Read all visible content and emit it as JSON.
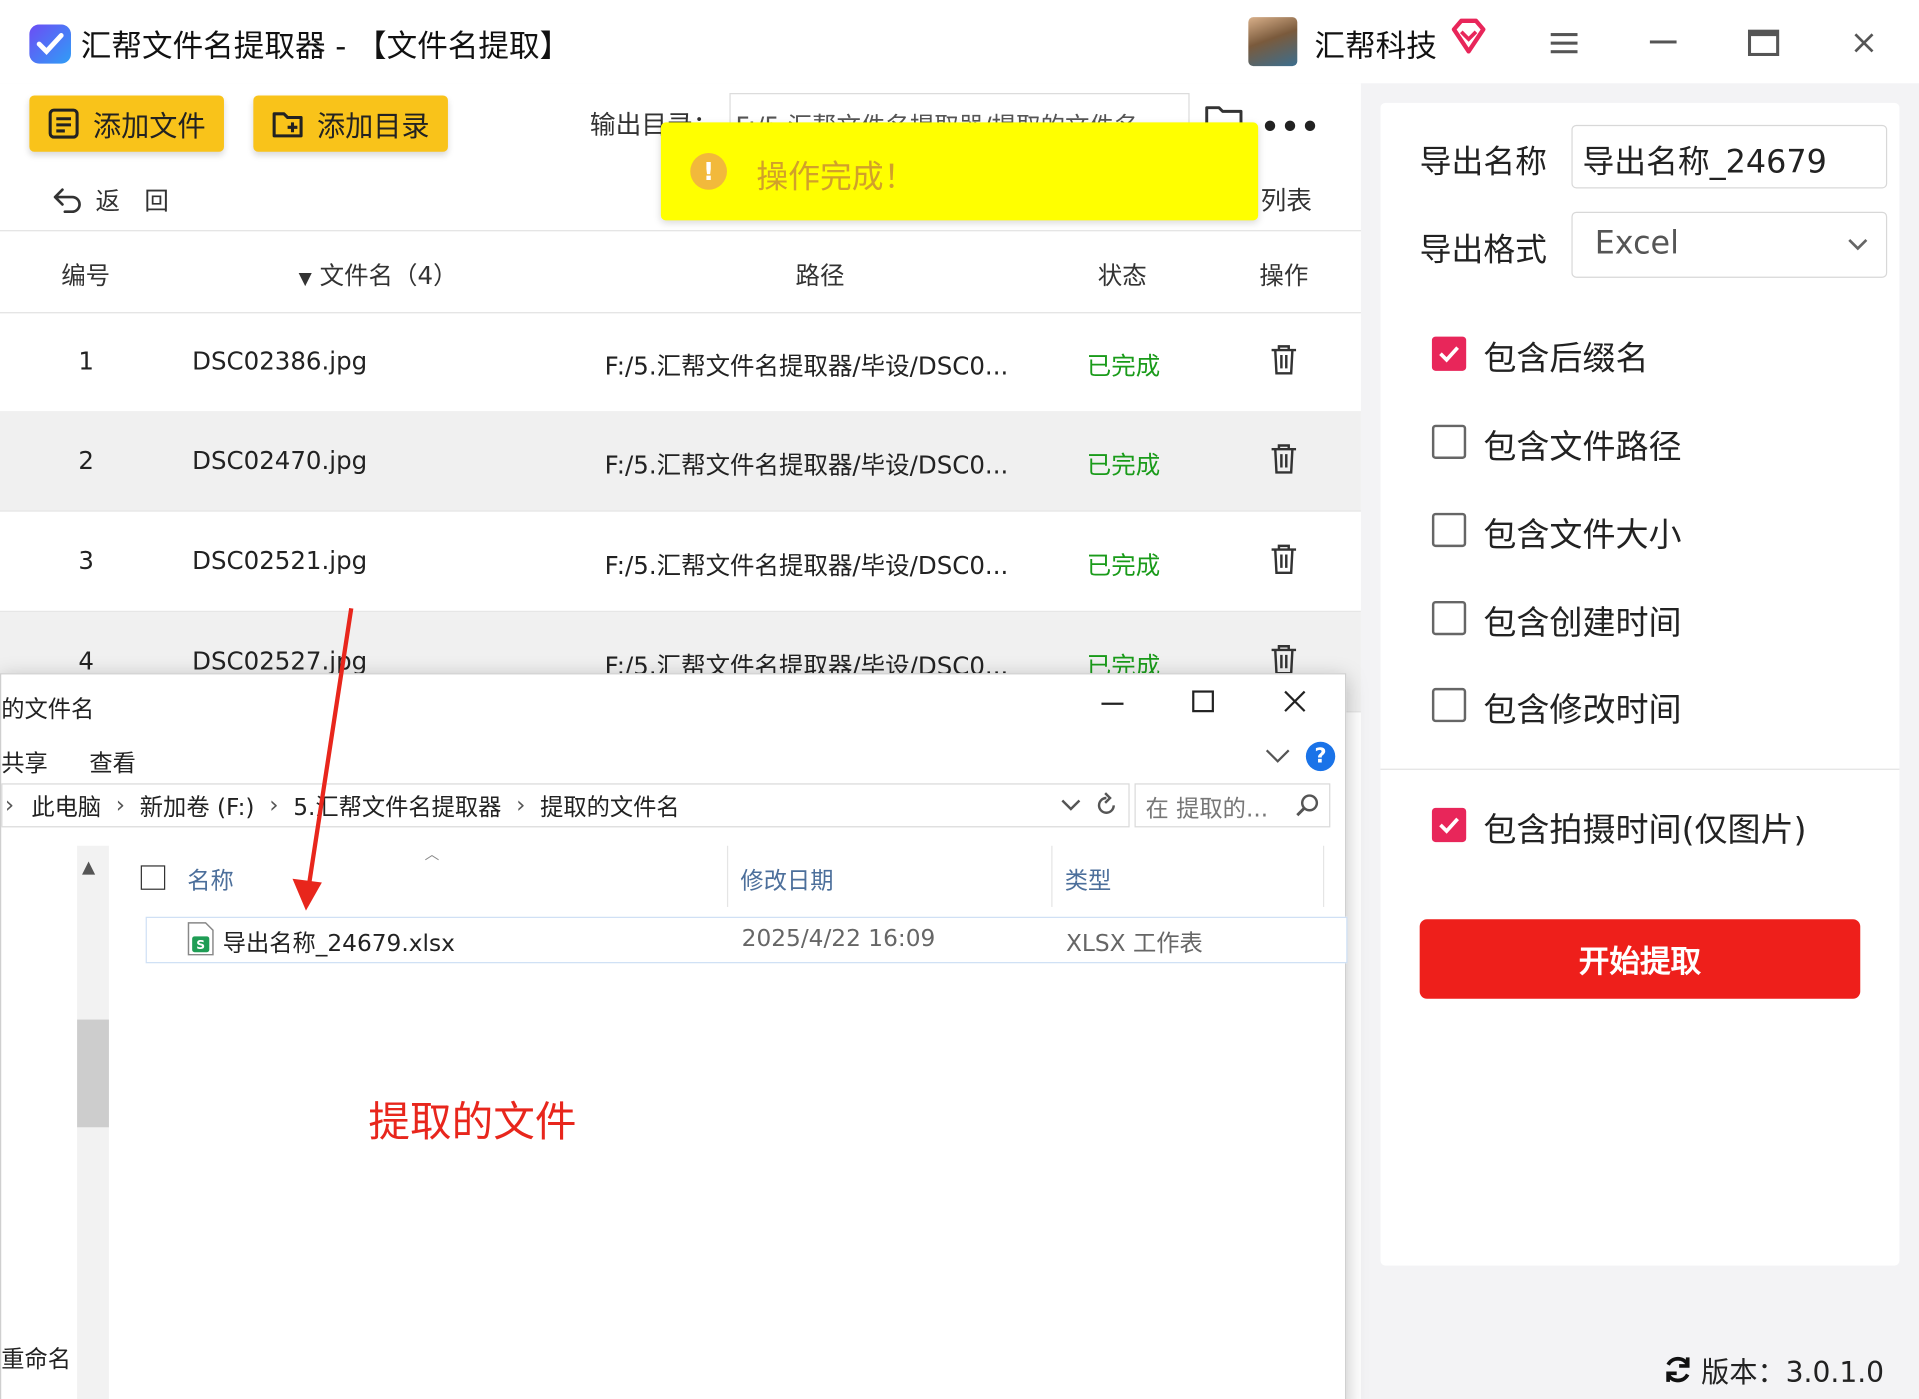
{
  "app": {
    "title": "汇帮文件名提取器 - 【文件名提取】",
    "brand": "汇帮科技",
    "version": "版本：3.0.1.0"
  },
  "toolbar": {
    "add_file": "添加文件",
    "add_dir": "添加目录",
    "output_dir_label": "输出目录：",
    "output_dir_value": "F:/5.汇帮文件名提取器/提取的文件名",
    "back": "返　回",
    "list_tail": "列表"
  },
  "toast": {
    "text": "操作完成！"
  },
  "table": {
    "headers": {
      "index": "编号",
      "name": "文件名（4）",
      "path": "路径",
      "status": "状态",
      "action": "操作"
    },
    "rows": [
      {
        "index": "1",
        "name": "DSC02386.jpg",
        "path": "F:/5.汇帮文件名提取器/毕设/DSC0...",
        "status": "已完成"
      },
      {
        "index": "2",
        "name": "DSC02470.jpg",
        "path": "F:/5.汇帮文件名提取器/毕设/DSC0...",
        "status": "已完成"
      },
      {
        "index": "3",
        "name": "DSC02521.jpg",
        "path": "F:/5.汇帮文件名提取器/毕设/DSC0...",
        "status": "已完成"
      },
      {
        "index": "4",
        "name": "DSC02527.jpg",
        "path": "F:/5.汇帮文件名提取器/毕设/DSC0...",
        "status": "已完成"
      }
    ]
  },
  "settings": {
    "export_name_label": "导出名称",
    "export_name_value": "导出名称_24679",
    "export_format_label": "导出格式",
    "export_format_value": "Excel",
    "options": [
      {
        "label": "包含后缀名",
        "checked": true
      },
      {
        "label": "包含文件路径",
        "checked": false
      },
      {
        "label": "包含文件大小",
        "checked": false
      },
      {
        "label": "包含创建时间",
        "checked": false
      },
      {
        "label": "包含修改时间",
        "checked": false
      }
    ],
    "photo_option": {
      "label": "包含拍摄时间(仅图片)",
      "checked": true
    },
    "start_button": "开始提取"
  },
  "explorer": {
    "title": "的文件名",
    "ribbon": [
      "共享",
      "查看"
    ],
    "breadcrumb": [
      "此电脑",
      "新加卷 (F:)",
      "5.汇帮文件名提取器",
      "提取的文件名"
    ],
    "search_placeholder": "在 提取的...",
    "columns": [
      "名称",
      "修改日期",
      "类型"
    ],
    "file": {
      "name": "导出名称_24679.xlsx",
      "date": "2025/4/22 16:09",
      "type": "XLSX 工作表"
    },
    "sidebar_partial": "重命名",
    "annotation": "提取的文件"
  },
  "colors": {
    "accent_yellow": "#f9c31a",
    "toast_yellow": "#ffff00",
    "checkbox_on": "#e8265a",
    "start_red": "#ee1f1b",
    "status_green": "#1a9b1a",
    "annotation_red": "#e8261c"
  }
}
